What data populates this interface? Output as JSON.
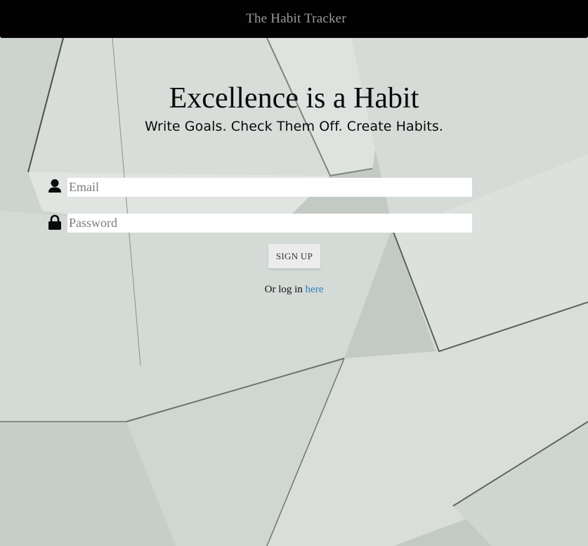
{
  "header": {
    "brand": "The Habit Tracker"
  },
  "hero": {
    "title": "Excellence is a Habit",
    "tagline": "Write Goals. Check Them Off. Create Habits."
  },
  "form": {
    "email_placeholder": "Email",
    "email_value": "",
    "email_icon": "user-icon",
    "password_placeholder": "Password",
    "password_value": "",
    "password_icon": "lock-icon",
    "submit_label": "SIGN UP"
  },
  "login": {
    "prefix": "Or log in",
    "link_text": "here"
  },
  "colors": {
    "header_bg": "#020202",
    "brand_text": "#9b9b9b",
    "link": "#2a7fc0",
    "button_bg": "#ececec",
    "background_paper": "#cfd5d1"
  }
}
